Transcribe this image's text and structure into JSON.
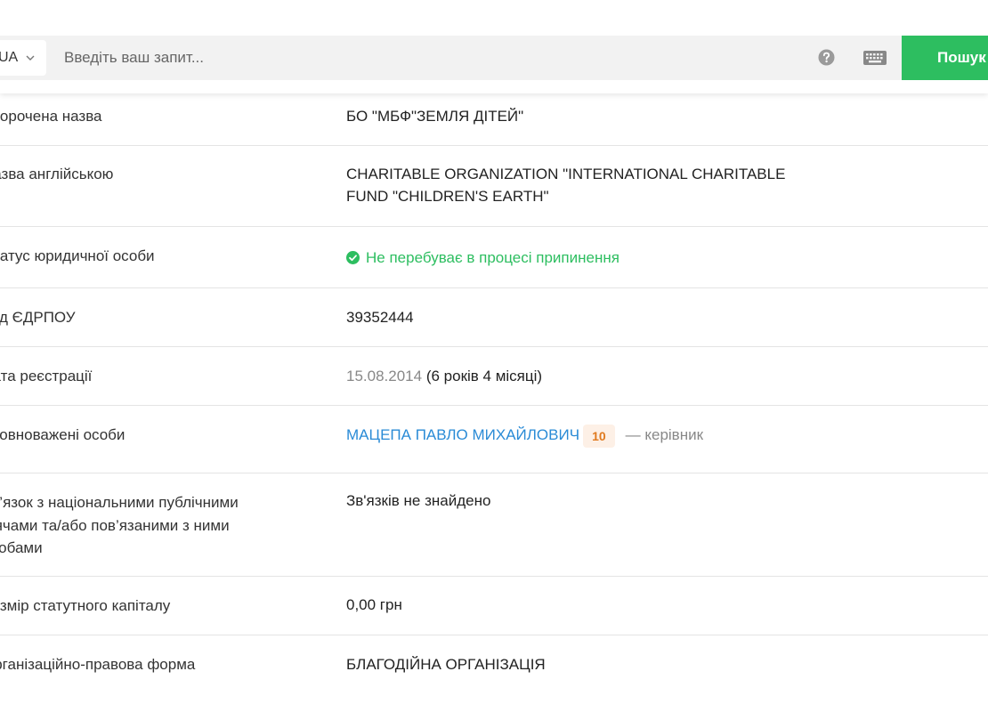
{
  "search": {
    "language": "UA",
    "placeholder": "Введіть ваш запит...",
    "button_label": "Пошук",
    "help_icon": "help-circle-icon",
    "keyboard_icon": "keyboard-icon"
  },
  "colors": {
    "accent": "#2dbe60",
    "link": "#2a8bd6",
    "badge_text": "#e07a1f",
    "badge_bg": "#fdf0e6",
    "muted": "#888888"
  },
  "details": [
    {
      "label": "Скорочена назва",
      "value": "БО \"МБФ\"ЗЕМЛЯ ДІТЕЙ\""
    },
    {
      "label": "Назва англійською",
      "value": "CHARITABLE ORGANIZATION \"INTERNATIONAL CHARITABLE FUND \"CHILDREN'S EARTH\""
    },
    {
      "label": "Статус юридичної особи",
      "value": "Не перебуває в процесі припинення",
      "icon": "check-circle-icon"
    },
    {
      "label": "Код ЄДРПОУ",
      "value": "39352444"
    },
    {
      "label": "Дата реєстрації",
      "date": "15.08.2014",
      "duration": "(6 років 4 місяці)"
    },
    {
      "label": "Уповноважені особи",
      "person": "МАЦЕПА ПАВЛО МИХАЙЛОВИЧ",
      "count": "10",
      "role": "— керівник"
    },
    {
      "label": "Зв’язок з національними публічними діячами та/або пов’язаними з ними особами",
      "value": "Зв'язків не знайдено"
    },
    {
      "label": "Розмір статутного капіталу",
      "value": "0,00 грн"
    },
    {
      "label": "Організаційно-правова форма",
      "value": "БЛАГОДІЙНА ОРГАНІЗАЦІЯ"
    }
  ]
}
